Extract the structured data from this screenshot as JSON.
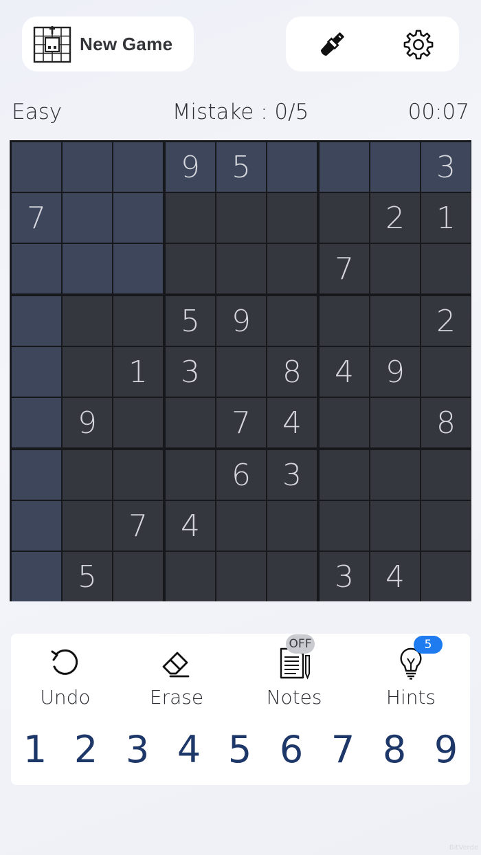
{
  "header": {
    "new_game_label": "New Game",
    "new_game_icon": "new-game-grid-icon",
    "theme_icon": "paint-brush-icon",
    "settings_icon": "gear-icon"
  },
  "status": {
    "difficulty": "Easy",
    "mistakes": "Mistake : 0/5",
    "timer": "00:07"
  },
  "board": {
    "rows": [
      [
        "",
        "",
        "",
        "9",
        "5",
        "",
        "",
        "",
        "3"
      ],
      [
        "7",
        "",
        "",
        "",
        "",
        "",
        "",
        "2",
        "1"
      ],
      [
        "",
        "",
        "",
        "",
        "",
        "",
        "7",
        "",
        ""
      ],
      [
        "",
        "",
        "",
        "5",
        "9",
        "",
        "",
        "",
        "2"
      ],
      [
        "",
        "",
        "1",
        "3",
        "",
        "8",
        "4",
        "9",
        ""
      ],
      [
        "",
        "9",
        "",
        "",
        "7",
        "4",
        "",
        "",
        "8"
      ],
      [
        "",
        "",
        "",
        "",
        "6",
        "3",
        "",
        "",
        ""
      ],
      [
        "",
        "",
        "7",
        "4",
        "",
        "",
        "",
        "",
        ""
      ],
      [
        "",
        "5",
        "",
        "",
        "",
        "",
        "3",
        "4",
        ""
      ]
    ],
    "selected_row": 0,
    "selected_col": 0,
    "cell_color": "#34373d",
    "highlight_color": "#3d465b"
  },
  "controls": {
    "undo_label": "Undo",
    "erase_label": "Erase",
    "notes_label": "Notes",
    "notes_state": "OFF",
    "hints_label": "Hints",
    "hints_count": "5",
    "hints_badge_color": "#1f7cf0"
  },
  "numpad": [
    "1",
    "2",
    "3",
    "4",
    "5",
    "6",
    "7",
    "8",
    "9"
  ],
  "watermark": "BitVerde"
}
